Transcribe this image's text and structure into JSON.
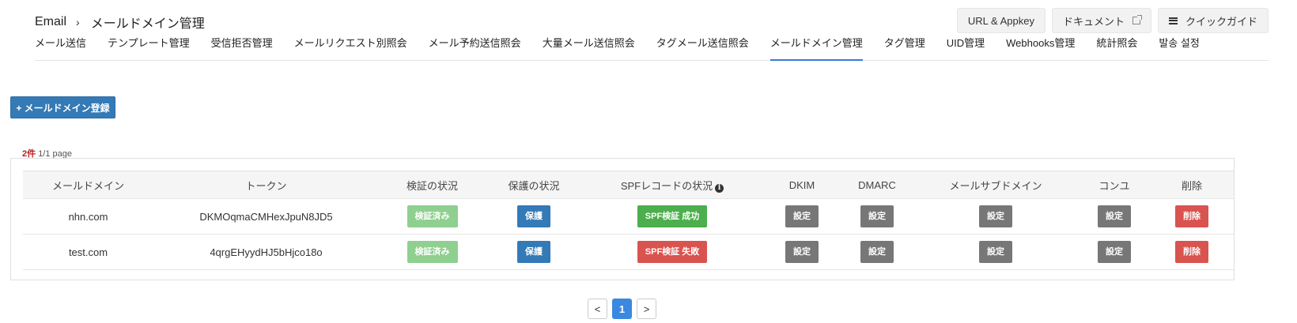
{
  "breadcrumb": {
    "root": "Email",
    "separator": "›",
    "current": "メールドメイン管理"
  },
  "top_buttons": {
    "url_appkey": "URL & Appkey",
    "document": "ドキュメント",
    "quick_guide": "クイックガイド"
  },
  "tabs": [
    {
      "label": "メール送信"
    },
    {
      "label": "テンプレート管理"
    },
    {
      "label": "受信拒否管理"
    },
    {
      "label": "メールリクエスト別照会"
    },
    {
      "label": "メール予約送信照会"
    },
    {
      "label": "大量メール送信照会"
    },
    {
      "label": "タグメール送信照会"
    },
    {
      "label": "メールドメイン管理",
      "active": true
    },
    {
      "label": "タグ管理"
    },
    {
      "label": "UID管理"
    },
    {
      "label": "Webhooks管理"
    },
    {
      "label": "統計照会"
    },
    {
      "label": "발송 설정"
    }
  ],
  "register_button": "+ メールドメイン登録",
  "count": {
    "number": "2件",
    "page": "1/1 page"
  },
  "table": {
    "headers": {
      "domain": "メールドメイン",
      "token": "トークン",
      "verification": "検証の状況",
      "protection": "保護の状況",
      "spf": "SPFレコードの状況",
      "dkim": "DKIM",
      "dmarc": "DMARC",
      "subdomain": "メールサブドメイン",
      "konyu": "コンユ",
      "delete": "削除"
    },
    "rows": [
      {
        "domain": "nhn.com",
        "token": "DKMOqmaCMHexJpuN8JD5",
        "verification": "検証済み",
        "protection": "保護",
        "spf": "SPF検証 成功",
        "spf_status": "success",
        "dkim": "設定",
        "dmarc": "設定",
        "subdomain": "設定",
        "konyu": "設定",
        "delete": "削除"
      },
      {
        "domain": "test.com",
        "token": "4qrgEHyydHJ5bHjco18o",
        "verification": "検証済み",
        "protection": "保護",
        "spf": "SPF検証 失敗",
        "spf_status": "fail",
        "dkim": "設定",
        "dmarc": "設定",
        "subdomain": "設定",
        "konyu": "設定",
        "delete": "削除"
      }
    ]
  },
  "pagination": {
    "prev": "<",
    "current": "1",
    "next": ">"
  },
  "colors": {
    "accent": "#3a7bd5",
    "verified": "#8fcf8f",
    "protect": "#337ab7",
    "success": "#4cae4c",
    "fail": "#d9534f",
    "setting": "#777777",
    "delete": "#d9534f"
  }
}
